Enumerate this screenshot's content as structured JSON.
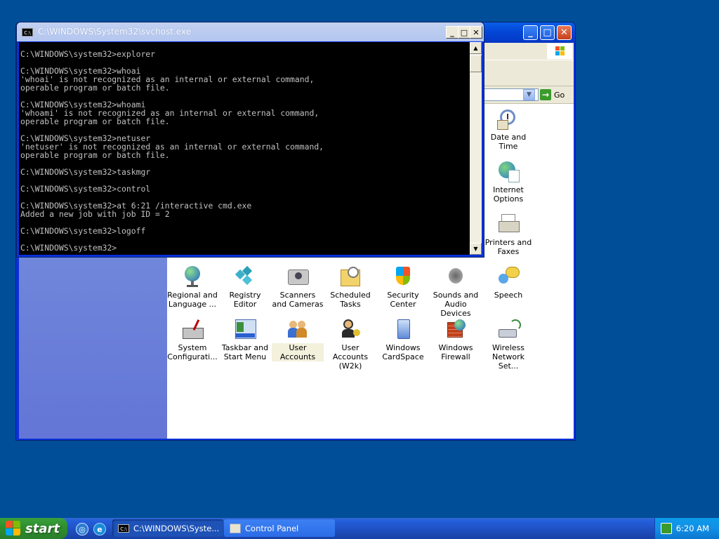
{
  "control_panel": {
    "go_label": "Go",
    "items": [
      {
        "label": "Date and Time",
        "icon": "date-time-icon"
      },
      {
        "label": "Internet Options",
        "icon": "internet-options-icon"
      },
      {
        "label": "Printers and Faxes",
        "icon": "printers-faxes-icon"
      },
      {
        "label": "Regional and Language ...",
        "icon": "regional-language-icon"
      },
      {
        "label": "Registry Editor",
        "icon": "registry-editor-icon"
      },
      {
        "label": "Scanners and Cameras",
        "icon": "scanners-cameras-icon"
      },
      {
        "label": "Scheduled Tasks",
        "icon": "scheduled-tasks-icon"
      },
      {
        "label": "Security Center",
        "icon": "security-center-icon"
      },
      {
        "label": "Sounds and Audio Devices",
        "icon": "sounds-audio-icon"
      },
      {
        "label": "Speech",
        "icon": "speech-icon"
      },
      {
        "label": "System Configurati...",
        "icon": "system-config-icon"
      },
      {
        "label": "Taskbar and Start Menu",
        "icon": "taskbar-start-menu-icon"
      },
      {
        "label": "User Accounts",
        "icon": "user-accounts-icon"
      },
      {
        "label": "User Accounts (W2k)",
        "icon": "user-accounts-w2k-icon"
      },
      {
        "label": "Windows CardSpace",
        "icon": "cardspace-icon"
      },
      {
        "label": "Windows Firewall",
        "icon": "firewall-icon"
      },
      {
        "label": "Wireless Network Set...",
        "icon": "wireless-network-icon"
      }
    ]
  },
  "console": {
    "title": "C:\\WINDOWS\\System32\\svchost.exe",
    "lines": [
      "C:\\WINDOWS\\system32>explorer",
      "",
      "C:\\WINDOWS\\system32>whoai",
      "'whoai' is not recognized as an internal or external command,",
      "operable program or batch file.",
      "",
      "C:\\WINDOWS\\system32>whoami",
      "'whoami' is not recognized as an internal or external command,",
      "operable program or batch file.",
      "",
      "C:\\WINDOWS\\system32>netuser",
      "'netuser' is not recognized as an internal or external command,",
      "operable program or batch file.",
      "",
      "C:\\WINDOWS\\system32>taskmgr",
      "",
      "C:\\WINDOWS\\system32>control",
      "",
      "C:\\WINDOWS\\system32>at 6:21 /interactive cmd.exe",
      "Added a new job with job ID = 2",
      "",
      "C:\\WINDOWS\\system32>logoff",
      "",
      "C:\\WINDOWS\\system32>"
    ]
  },
  "taskbar": {
    "start_label": "start",
    "tasks": [
      {
        "label": "C:\\WINDOWS\\Syste..."
      },
      {
        "label": "Control Panel"
      }
    ],
    "clock": "6:20 AM"
  }
}
